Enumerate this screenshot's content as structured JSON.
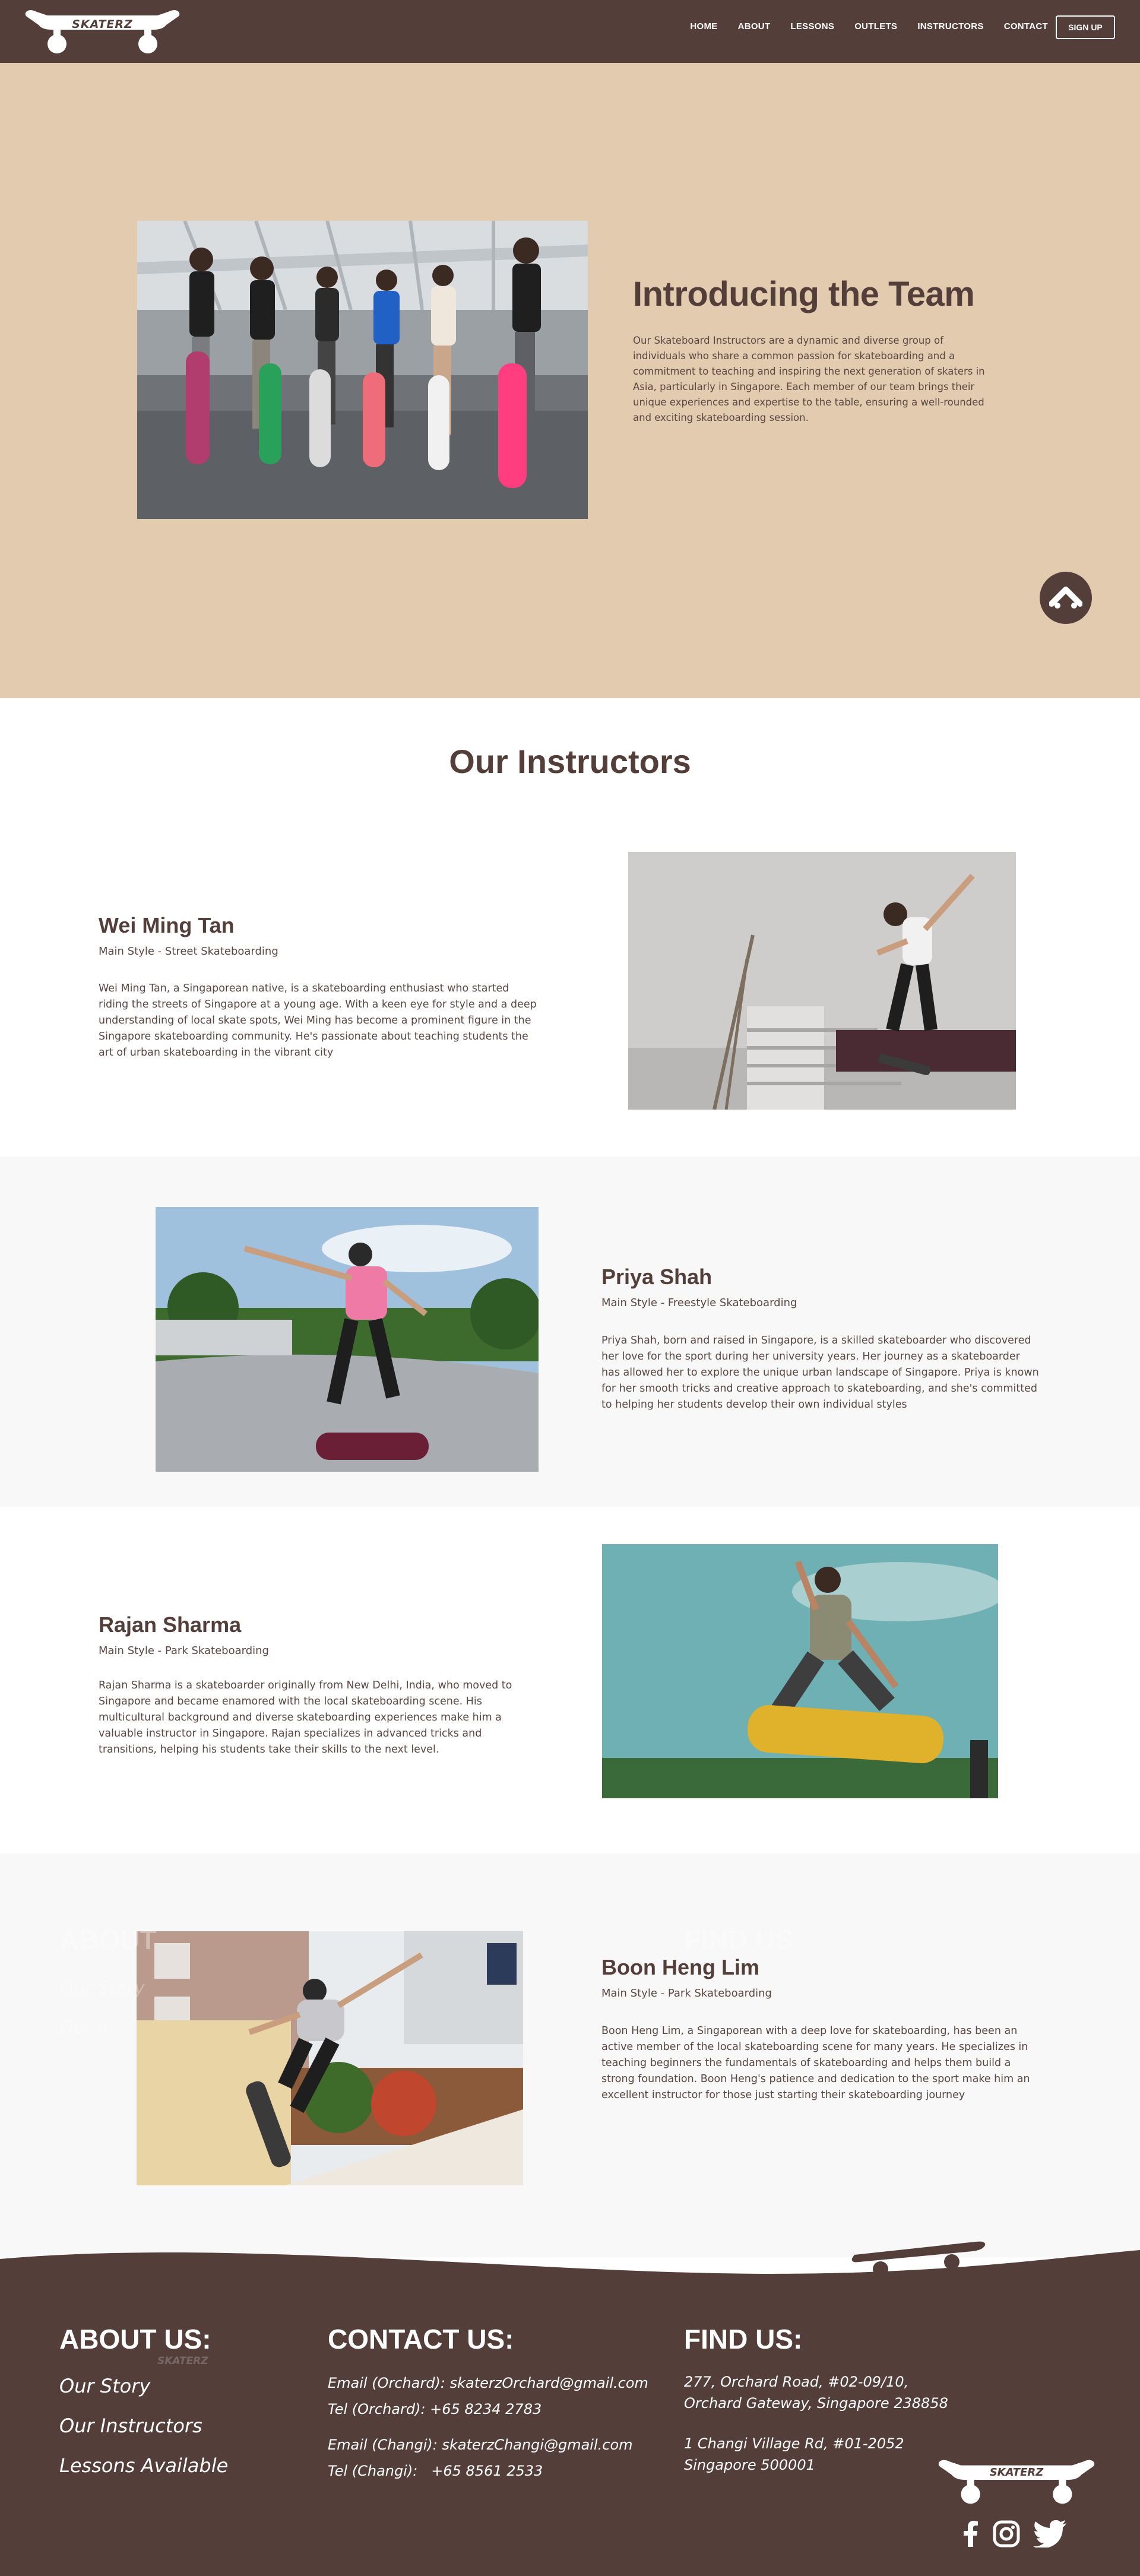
{
  "brand": {
    "logo_text": "SKATERZ"
  },
  "nav": {
    "links": [
      "HOME",
      "ABOUT",
      "LESSONS",
      "OUTLETS",
      "INSTRUCTORS",
      "CONTACT"
    ],
    "signup_label": "SIGN UP"
  },
  "hero": {
    "title": "Introducing the Team",
    "description": "Our Skateboard Instructors are a dynamic and diverse group of individuals who share a common passion for skateboarding and a commitment to teaching and inspiring the next generation of skaters in Asia, particularly in Singapore. Each member of our team brings their unique experiences and expertise to the table, ensuring a well-rounded and exciting skateboarding session."
  },
  "instructors_section": {
    "title": "Our Instructors",
    "items": [
      {
        "name": "Wei Ming Tan",
        "style": "Main Style - Street Skateboarding",
        "bio": "Wei Ming Tan, a Singaporean native, is a skateboarding enthusiast who started riding the streets of Singapore at a young age. With a keen eye for style and a deep understanding of local skate spots, Wei Ming has become a prominent figure in the Singapore skateboarding community. He's passionate about teaching students the art of urban skateboarding in the vibrant city"
      },
      {
        "name": "Priya Shah",
        "style": "Main Style - Freestyle Skateboarding",
        "bio": "Priya Shah, born and raised in Singapore, is a skilled skateboarder who discovered her love for the sport during her university years. Her journey as a skateboarder has allowed her to explore the unique urban landscape of Singapore. Priya is known for her smooth tricks and creative approach to skateboarding, and she's committed to helping her students develop their own individual styles"
      },
      {
        "name": "Rajan Sharma",
        "style": "Main Style - Park Skateboarding",
        "bio": "Rajan Sharma is a skateboarder originally from New Delhi, India, who moved to Singapore and became enamored with the local skateboarding scene. His multicultural background and diverse skateboarding experiences make him a valuable instructor in Singapore. Rajan specializes in advanced tricks and transitions, helping his students take their skills to the next level."
      },
      {
        "name": "Boon Heng Lim",
        "style": "Main Style - Park Skateboarding",
        "bio": "Boon Heng Lim, a Singaporean with a deep love for skateboarding, has been an active member of the local skateboarding scene for many years. He specializes in teaching beginners the fundamentals of skateboarding and helps them build a strong foundation. Boon Heng's patience and dedication to the sport make him an excellent instructor for those just starting their skateboarding journey"
      }
    ]
  },
  "footer": {
    "about": {
      "heading": "ABOUT US:",
      "links": [
        "Our Story",
        "Our Instructors",
        "Lessons Available"
      ]
    },
    "contact": {
      "heading": "CONTACT US:",
      "lines": [
        "Email (Orchard): skaterzOrchard@gmail.com",
        "Tel (Orchard): +65 8234 2783",
        "Email (Changi): skaterzChangi@gmail.com",
        "Tel (Changi):   +65 8561 2533"
      ]
    },
    "find": {
      "heading": "FIND US:",
      "addresses": [
        [
          "277, Orchard Road, #02-09/10,",
          "Orchard Gateway, Singapore 238858"
        ],
        [
          "1 Changi Village Rd, #01-2052",
          "Singapore 500001"
        ]
      ]
    },
    "icons": [
      "facebook-icon",
      "instagram-icon",
      "twitter-icon"
    ]
  },
  "colors": {
    "brown": "#533e3a",
    "sand": "#e3cbaf",
    "band": "#f8f8f8"
  }
}
